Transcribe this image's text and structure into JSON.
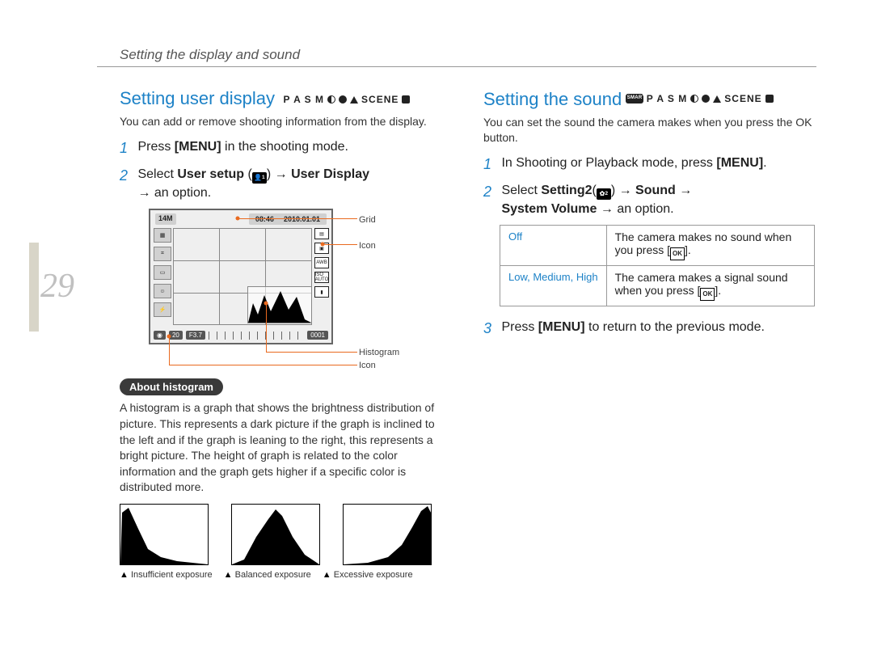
{
  "page_number": "29",
  "header": "Setting the display and sound",
  "left": {
    "title": "Setting user display",
    "modes": "P A S M",
    "modes_scene": "SCENE",
    "intro": "You can add or remove shooting information from the display.",
    "step1_pre": "Press ",
    "step1_bold": "[MENU]",
    "step1_post": " in the shooting mode.",
    "step2_pre": "Select ",
    "step2_b1": "User setup",
    "step2_icon_sub": "1",
    "step2_mid": " → ",
    "step2_b2": "User Display",
    "step2_post": " → an option.",
    "callouts": {
      "grid": "Grid",
      "icon1": "Icon",
      "histogram": "Histogram",
      "icon2": "Icon"
    },
    "lcd": {
      "res": "14M",
      "time": "08:46",
      "date": "2010.01.01",
      "awb": "AWB",
      "iso": "ISO AUTO",
      "shutter": "20",
      "fnum": "F3.7",
      "counter": "0001"
    },
    "about_title": "About histogram",
    "about_body": "A histogram is a graph that shows the brightness distribution of picture. This represents a dark picture if the graph is inclined to the left and if the graph is leaning to the right, this represents a bright picture. The height of graph is related to the color information and the graph gets higher if a specific color is distributed more.",
    "hist_labels": {
      "a": "Insufficient exposure",
      "b": "Balanced exposure",
      "c": "Excessive exposure"
    }
  },
  "right": {
    "title": "Setting the sound",
    "modes": "P A S M",
    "modes_scene": "SCENE",
    "intro": "You can set the sound the camera makes when you press the OK button.",
    "step1_pre": "In Shooting or Playback mode, press ",
    "step1_bold": "[MENU]",
    "step1_post": ".",
    "step2_pre": "Select ",
    "step2_b1": "Setting2",
    "step2_icon_sub": "2",
    "step2_mid1": " → ",
    "step2_b2": "Sound",
    "step2_mid2": " → ",
    "step2_b3": "System Volume",
    "step2_post": " → an option.",
    "table": {
      "row1_key": "Off",
      "row1_val_pre": "The camera makes no sound when you press [",
      "row1_val_post": "].",
      "row2_key": "Low, Medium, High",
      "row2_val_pre": "The camera makes a signal sound when you press [",
      "row2_val_post": "]."
    },
    "step3_pre": "Press ",
    "step3_bold": "[MENU]",
    "step3_post": " to return to the previous mode."
  }
}
